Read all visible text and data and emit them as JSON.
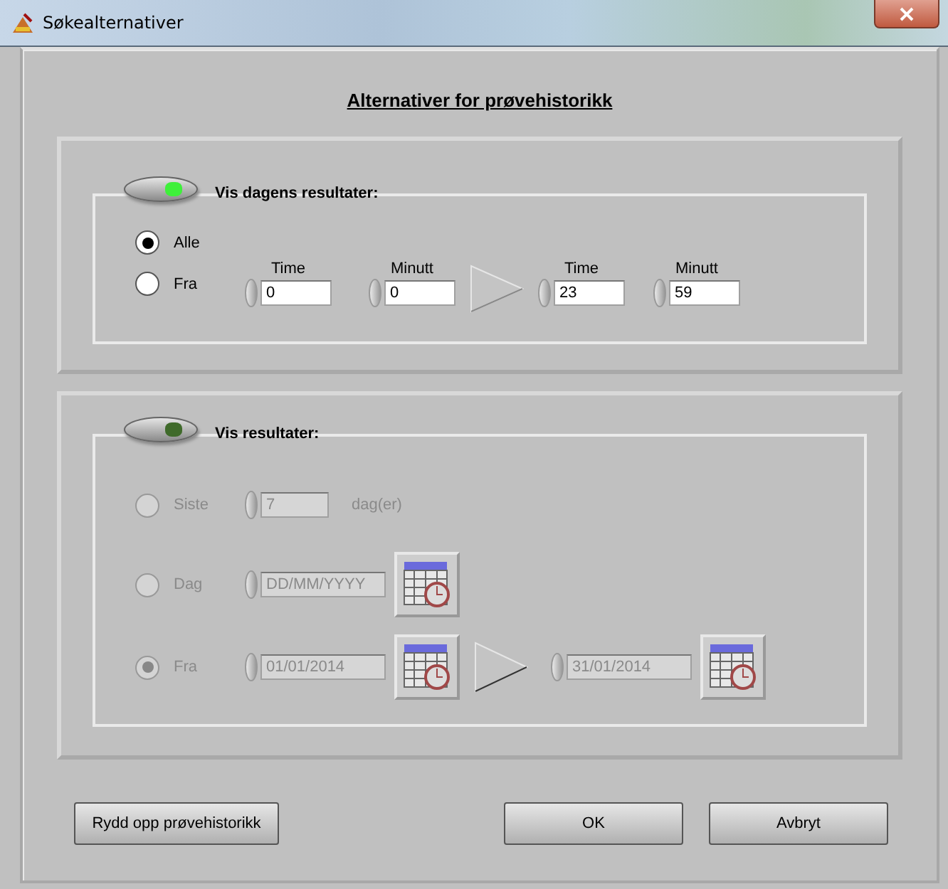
{
  "window": {
    "title": "Søkealternativer"
  },
  "heading": "Alternativer for prøvehistorikk",
  "today": {
    "on": true,
    "label": "Vis dagens resultater:",
    "disabled": false,
    "options": [
      {
        "label": "Alle",
        "selected": true
      },
      {
        "label": "Fra",
        "selected": false
      }
    ],
    "time_fields": [
      {
        "label": "Time",
        "value": "0"
      },
      {
        "label": "Minutt",
        "value": "0"
      },
      {
        "label": "Time",
        "value": "23"
      },
      {
        "label": "Minutt",
        "value": "59"
      }
    ]
  },
  "results": {
    "on": false,
    "label": "Vis resultater:",
    "disabled": true,
    "options": [
      {
        "kind": "count",
        "label": "Siste",
        "selected": false,
        "value": "7",
        "unit": "dag(er)"
      },
      {
        "kind": "date",
        "label": "Dag",
        "selected": false,
        "placeholder": "DD/MM/YYYY"
      },
      {
        "kind": "range",
        "label": "Fra",
        "selected": true,
        "from": "01/01/2014",
        "to": "31/01/2014"
      }
    ]
  },
  "buttons": [
    {
      "label": "Rydd opp prøvehistorikk"
    },
    {
      "label": "OK"
    },
    {
      "label": "Avbryt"
    }
  ]
}
